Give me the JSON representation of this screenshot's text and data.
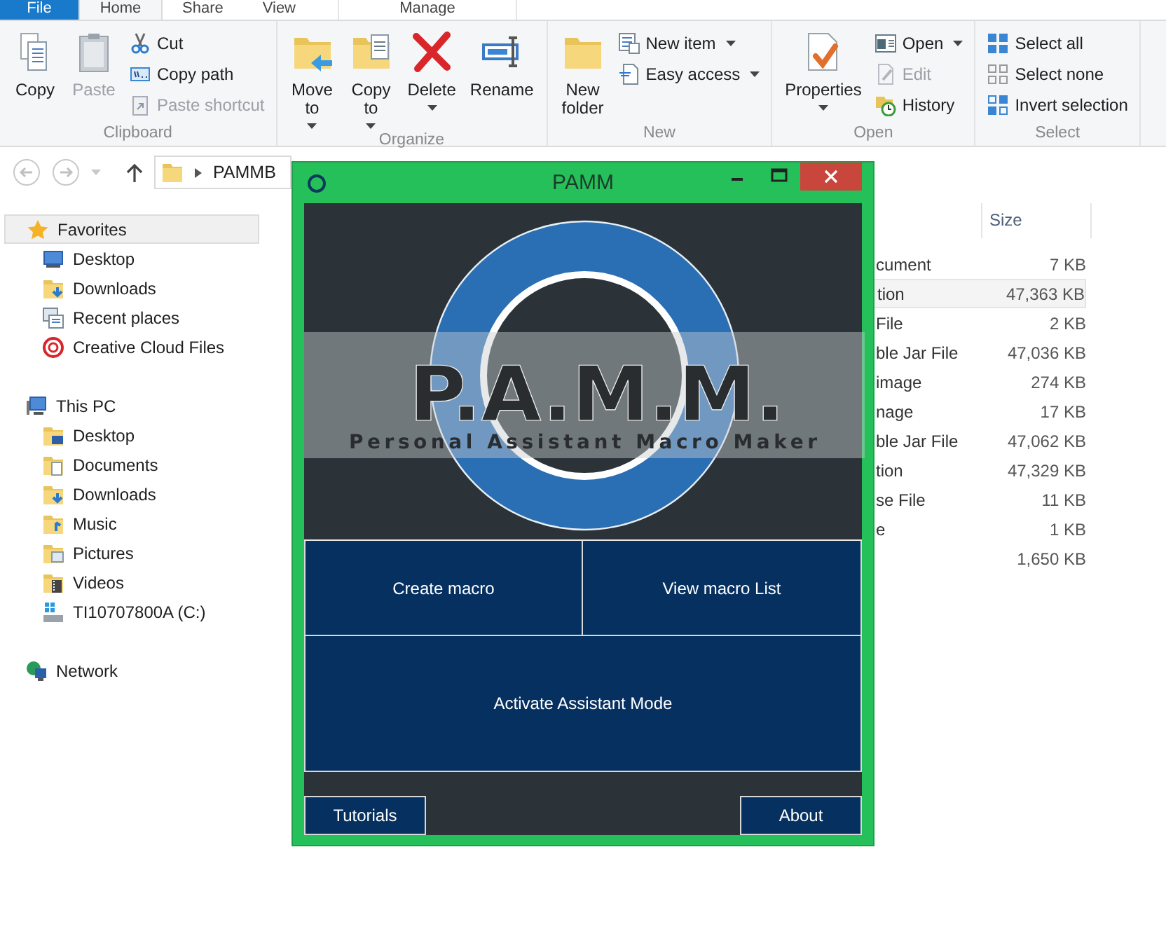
{
  "ribbon_tabs": [
    {
      "label": "File",
      "kind": "file",
      "selected": false
    },
    {
      "label": "Home",
      "kind": "tab",
      "selected": true
    },
    {
      "label": "Share",
      "kind": "tab",
      "selected": false
    },
    {
      "label": "View",
      "kind": "tab",
      "selected": false
    },
    {
      "label": "Manage",
      "kind": "contextual",
      "selected": false
    }
  ],
  "ribbon_groups": [
    {
      "label": "Clipboard",
      "buttons": [
        {
          "label": "Copy",
          "dropdown": false,
          "disabled": false
        },
        {
          "label": "Paste",
          "dropdown": false,
          "disabled": true
        }
      ],
      "small_buttons": [
        {
          "label": "Cut",
          "dropdown": false,
          "disabled": false
        },
        {
          "label": "Copy path",
          "dropdown": false,
          "disabled": false
        },
        {
          "label": "Paste shortcut",
          "dropdown": false,
          "disabled": true
        }
      ]
    },
    {
      "label": "Organize",
      "buttons": [
        {
          "label": "Move to",
          "dropdown": true,
          "disabled": false
        },
        {
          "label": "Copy to",
          "dropdown": true,
          "disabled": false
        },
        {
          "label": "Delete",
          "dropdown": true,
          "disabled": false
        },
        {
          "label": "Rename",
          "dropdown": false,
          "disabled": false
        }
      ]
    },
    {
      "label": "New",
      "buttons": [
        {
          "label": "New folder",
          "dropdown": false,
          "disabled": false
        }
      ],
      "small_buttons": [
        {
          "label": "New item",
          "dropdown": true,
          "disabled": false
        },
        {
          "label": "Easy access",
          "dropdown": true,
          "disabled": false
        }
      ]
    },
    {
      "label": "Open",
      "buttons": [
        {
          "label": "Properties",
          "dropdown": true,
          "disabled": false
        }
      ],
      "small_buttons": [
        {
          "label": "Open",
          "dropdown": true,
          "disabled": false
        },
        {
          "label": "Edit",
          "dropdown": false,
          "disabled": true
        },
        {
          "label": "History",
          "dropdown": false,
          "disabled": false
        }
      ]
    },
    {
      "label": "Select",
      "small_buttons": [
        {
          "label": "Select all",
          "dropdown": false,
          "disabled": false
        },
        {
          "label": "Select none",
          "dropdown": false,
          "disabled": false
        },
        {
          "label": "Invert selection",
          "dropdown": false,
          "disabled": false
        }
      ]
    }
  ],
  "address_bar": {
    "path": [
      "PAMMB"
    ]
  },
  "navigation": [
    {
      "label": "Favorites",
      "selected": true,
      "children": [
        {
          "label": "Desktop",
          "selected": false
        },
        {
          "label": "Downloads",
          "selected": false
        },
        {
          "label": "Recent places",
          "selected": false
        },
        {
          "label": "Creative Cloud Files",
          "selected": false
        }
      ]
    },
    {
      "label": "This PC",
      "selected": false,
      "children": [
        {
          "label": "Desktop",
          "selected": false
        },
        {
          "label": "Documents",
          "selected": false
        },
        {
          "label": "Downloads",
          "selected": false
        },
        {
          "label": "Music",
          "selected": false
        },
        {
          "label": "Pictures",
          "selected": false
        },
        {
          "label": "Videos",
          "selected": false
        },
        {
          "label": "TI10707800A (C:)",
          "selected": false
        }
      ]
    },
    {
      "label": "Network",
      "selected": false
    }
  ],
  "file_list": {
    "size_header": "Size",
    "rows": [
      {
        "column_2": "cument",
        "size": "7 KB",
        "hovered": false
      },
      {
        "column_2": "tion",
        "size": "47,363 KB",
        "hovered": true
      },
      {
        "column_2": "File",
        "size": "2 KB",
        "hovered": false
      },
      {
        "column_2": "ble Jar File",
        "size": "47,036 KB",
        "hovered": false
      },
      {
        "column_2": "image",
        "size": "274 KB",
        "hovered": false
      },
      {
        "column_2": "nage",
        "size": "17 KB",
        "hovered": false
      },
      {
        "column_2": "ble Jar File",
        "size": "47,062 KB",
        "hovered": false
      },
      {
        "column_2": "tion",
        "size": "47,329 KB",
        "hovered": false
      },
      {
        "column_2": "se File",
        "size": "11 KB",
        "hovered": false
      },
      {
        "column_2": "e",
        "size": "1 KB",
        "hovered": false
      },
      {
        "size": "1,650 KB",
        "hovered": false
      }
    ]
  },
  "pamm_window": {
    "title": "PAMM",
    "logo_title": "P.A.M.M.",
    "logo_subtitle": "Personal Assistant Macro Maker",
    "buttons": [
      {
        "label": "Create macro"
      },
      {
        "label": "View macro List"
      },
      {
        "label": "Activate Assistant Mode"
      }
    ],
    "footer_buttons": [
      {
        "label": "Tutorials"
      },
      {
        "label": "About"
      }
    ]
  }
}
